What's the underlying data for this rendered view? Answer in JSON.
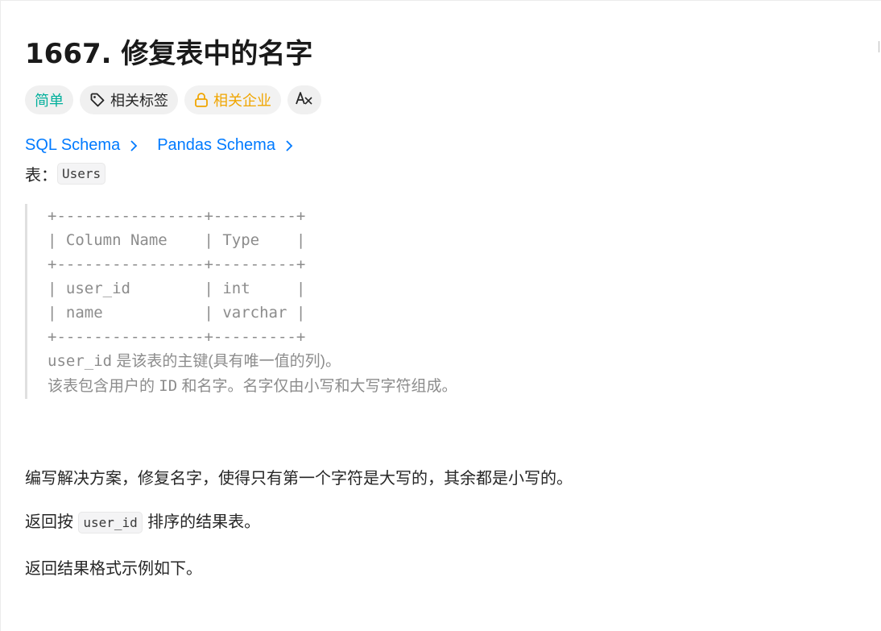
{
  "problem": {
    "title": "1667. 修复表中的名字"
  },
  "tags": {
    "difficulty": "简单",
    "related_tags": "相关标签",
    "related_companies": "相关企业",
    "translate_icon_text": "A文"
  },
  "schema_links": [
    {
      "label": "SQL Schema"
    },
    {
      "label": "Pandas Schema"
    }
  ],
  "table_intro": {
    "label": "表：",
    "name": "Users"
  },
  "schema_table": {
    "lines": [
      "+----------------+---------+",
      "| Column Name    | Type    |",
      "+----------------+---------+",
      "| user_id        | int     |",
      "| name           | varchar |",
      "+----------------+---------+"
    ],
    "note1_code": "user_id",
    "note1_text": " 是该表的主键(具有唯一值的列)。",
    "note2_pre": "该表包含用户的 ",
    "note2_code": "ID",
    "note2_post": " 和名字。名字仅由小写和大写字符组成。"
  },
  "description": {
    "p1": "编写解决方案，修复名字，使得只有第一个字符是大写的，其余都是小写的。",
    "p2_pre": "返回按 ",
    "p2_code": "user_id",
    "p2_post": " 排序的结果表。",
    "p3": "返回结果格式示例如下。"
  },
  "colors": {
    "easy": "#00af9b",
    "company": "#f0a500",
    "link": "#007aff",
    "muted": "#8c8c8c"
  }
}
